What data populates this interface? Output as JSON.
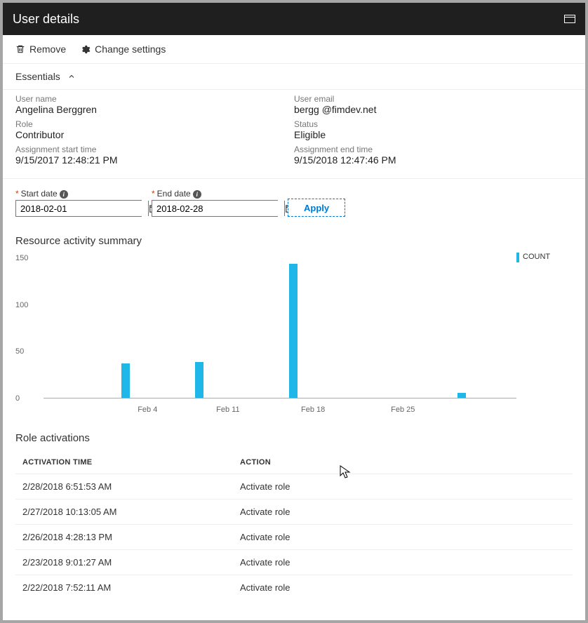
{
  "title": "User details",
  "toolbar": {
    "remove": "Remove",
    "change_settings": "Change settings"
  },
  "essentials": {
    "header": "Essentials",
    "left": {
      "user_name_lbl": "User name",
      "user_name": "Angelina Berggren",
      "role_lbl": "Role",
      "role": "Contributor",
      "start_lbl": "Assignment start time",
      "start": "9/15/2017 12:48:21 PM"
    },
    "right": {
      "email_lbl": "User email",
      "email": "bergg @fimdev.net",
      "status_lbl": "Status",
      "status": "Eligible",
      "end_lbl": "Assignment end time",
      "end": "9/15/2018 12:47:46 PM"
    }
  },
  "dates": {
    "start_lbl": "Start date",
    "start": "2018-02-01",
    "end_lbl": "End date",
    "end": "2018-02-28",
    "apply": "Apply"
  },
  "activity_summary_title": "Resource activity summary",
  "chart_data": {
    "type": "bar",
    "title": "Resource activity summary",
    "xlabel": "",
    "ylabel": "",
    "ylim": [
      0,
      150
    ],
    "yticks": [
      0,
      50,
      100,
      150
    ],
    "xticks": [
      "Feb 4",
      "Feb 11",
      "Feb 18",
      "Feb 25"
    ],
    "legend": "COUNT",
    "bars": [
      {
        "pos_pct": 16.5,
        "value": 37
      },
      {
        "pos_pct": 32.0,
        "value": 38
      },
      {
        "pos_pct": 52.0,
        "value": 143
      },
      {
        "pos_pct": 87.5,
        "value": 5
      }
    ],
    "xtick_positions_pct": [
      22,
      39,
      57,
      76
    ]
  },
  "activations": {
    "title": "Role activations",
    "col1": "ACTIVATION TIME",
    "col2": "ACTION",
    "rows": [
      {
        "time": "2/28/2018 6:51:53 AM",
        "action": "Activate role"
      },
      {
        "time": "2/27/2018 10:13:05 AM",
        "action": "Activate role"
      },
      {
        "time": "2/26/2018 4:28:13 PM",
        "action": "Activate role"
      },
      {
        "time": "2/23/2018 9:01:27 AM",
        "action": "Activate role"
      },
      {
        "time": "2/22/2018 7:52:11 AM",
        "action": "Activate role"
      }
    ]
  }
}
